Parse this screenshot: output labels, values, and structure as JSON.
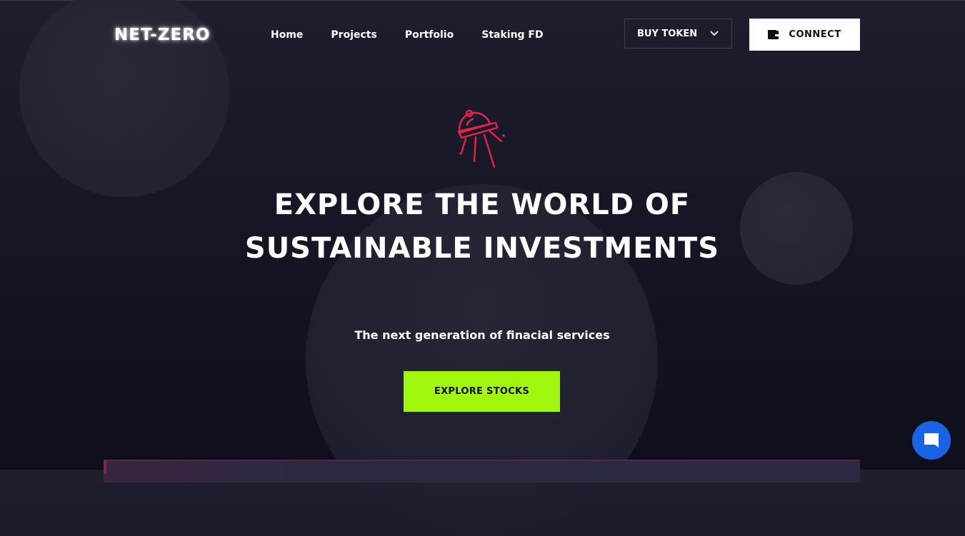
{
  "brand": {
    "logo": "NET-ZERO"
  },
  "nav": {
    "items": [
      "Home",
      "Projects",
      "Portfolio",
      "Staking FD"
    ]
  },
  "header": {
    "buy_token_label": "BUY TOKEN",
    "connect_label": "CONNECT"
  },
  "hero": {
    "title": "EXPLORE THE WORLD OF SUSTAINABLE INVESTMENTS",
    "subtitle": "The next generation of finacial services",
    "cta_label": "EXPLORE STOCKS"
  },
  "icons": {
    "hero": "satellite-icon",
    "buy_token": "chevron-down-icon",
    "connect": "wallet-icon",
    "chat": "chat-icon"
  },
  "colors": {
    "background": "#171626",
    "accent_green": "#a2f70f",
    "accent_red": "#e8234b",
    "chat_blue": "#1863e6"
  }
}
